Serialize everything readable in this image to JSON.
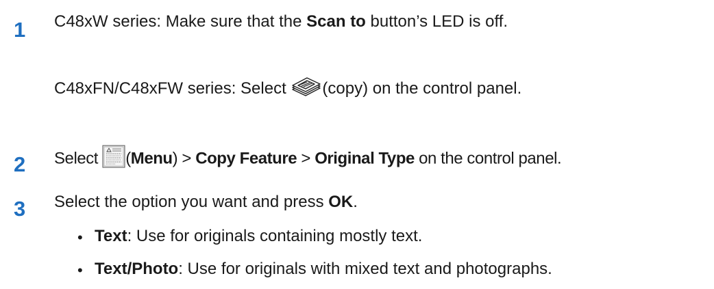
{
  "steps": [
    {
      "number": "1",
      "lines": [
        {
          "prefix": "C48xW series: Make sure that the ",
          "bold": "Scan to",
          "suffix": " button’s LED is off."
        },
        {
          "prefix": "C48xFN/C48xFW series: Select ",
          "icon": "copy-icon",
          "suffix": "(copy) on the control panel."
        }
      ]
    },
    {
      "number": "2",
      "prefix": "Select ",
      "icon": "menu-icon",
      "paren_open": "(",
      "menu_label": "Menu",
      "paren_close": ")",
      "sep1": " > ",
      "item1": "Copy Feature",
      "sep2": " > ",
      "item2": "Original Type",
      "suffix": " on the control panel."
    },
    {
      "number": "3",
      "prefix": "Select the option you want and press ",
      "bold": "OK",
      "suffix": "."
    }
  ],
  "options": [
    {
      "bullet": "•",
      "name": "Text",
      "desc": ": Use for originals containing mostly text."
    },
    {
      "bullet": "•",
      "name": "Text/Photo",
      "desc": ": Use for originals with mixed text and photographs."
    }
  ]
}
